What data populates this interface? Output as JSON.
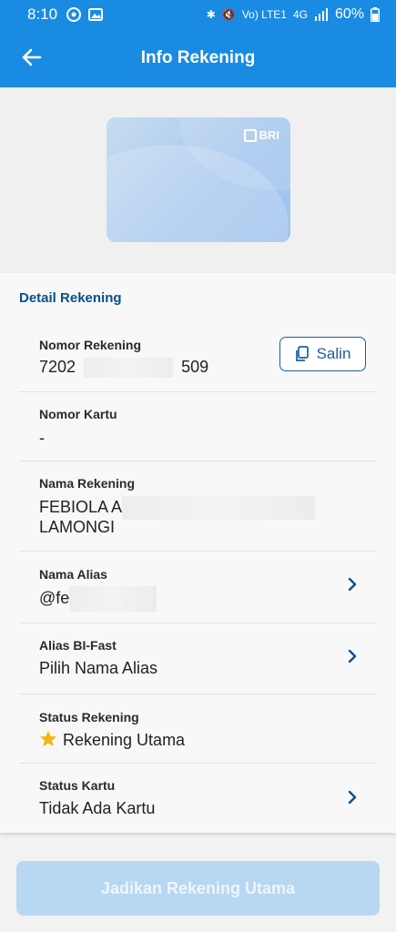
{
  "status_bar": {
    "time": "8:10",
    "network": "Vo) LTE1",
    "signal": "4G",
    "battery": "60%"
  },
  "appbar": {
    "title": "Info Rekening"
  },
  "card": {
    "brand": "BRI"
  },
  "detail": {
    "section_title": "Detail Rekening",
    "nomor_rekening": {
      "label": "Nomor Rekening",
      "prefix": "7202",
      "suffix": "509",
      "copy_label": "Salin"
    },
    "nomor_kartu": {
      "label": "Nomor Kartu",
      "value": "-"
    },
    "nama_rekening": {
      "label": "Nama Rekening",
      "line1": "FEBIOLA A",
      "line2": "LAMONGI"
    },
    "nama_alias": {
      "label": "Nama Alias",
      "value": "@fe"
    },
    "alias_bi_fast": {
      "label": "Alias BI-Fast",
      "value": "Pilih Nama Alias"
    },
    "status_rekening": {
      "label": "Status Rekening",
      "value": "Rekening Utama"
    },
    "status_kartu": {
      "label": "Status Kartu",
      "value": "Tidak Ada Kartu"
    }
  },
  "bottom_button": {
    "label": "Jadikan Rekening Utama"
  },
  "colors": {
    "primary": "#1a8be3",
    "accent": "#0b4f8a",
    "star": "#f5b50a",
    "button_disabled": "#b8d7f2"
  }
}
